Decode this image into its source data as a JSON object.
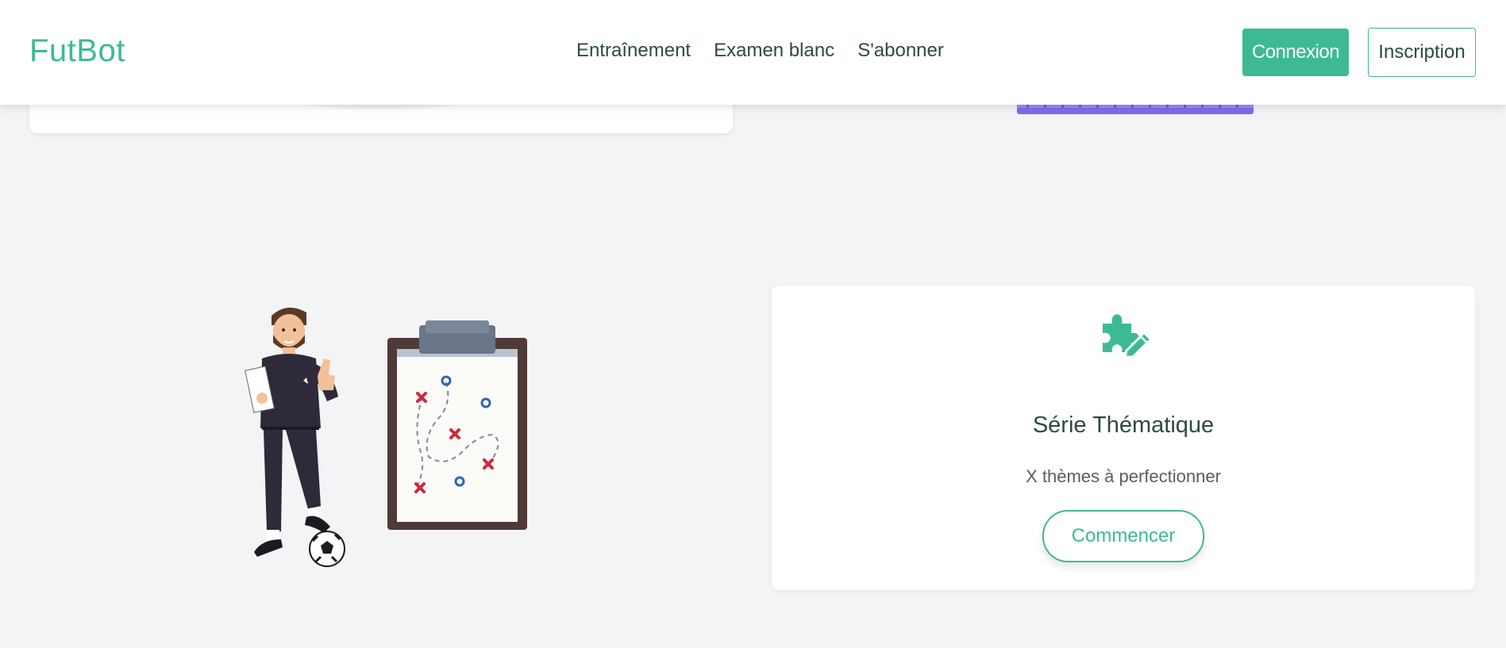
{
  "header": {
    "brand": "FutBot",
    "nav": [
      "Entraînement",
      "Examen blanc",
      "S'abonner"
    ],
    "login_label": "Connexion",
    "signup_label": "Inscription"
  },
  "feature": {
    "icon": "puzzle-pencil-icon",
    "title": "Série Thématique",
    "subtitle": "X thèmes à perfectionner",
    "button_label": "Commencer"
  },
  "illustration": {
    "icon": "coach-with-tactics-board-illustration"
  },
  "colors": {
    "accent": "#3dba94",
    "background": "#f3f4f6",
    "text": "#2f4a40"
  }
}
